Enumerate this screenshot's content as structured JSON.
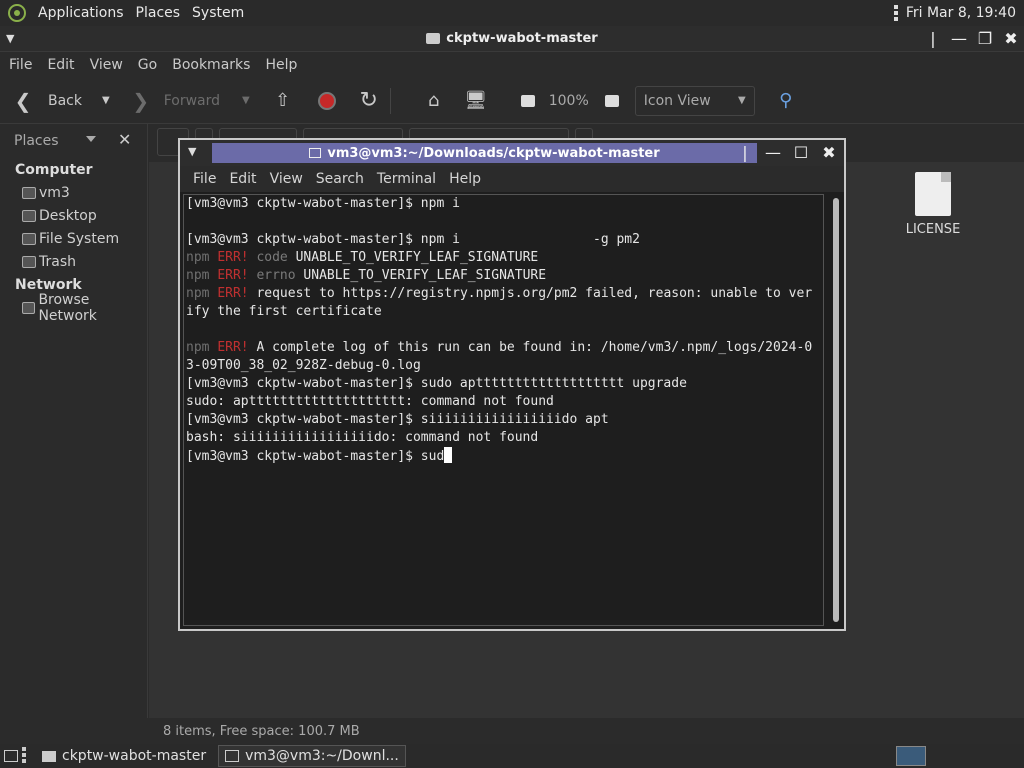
{
  "top_panel": {
    "menus": [
      "Applications",
      "Places",
      "System"
    ],
    "clock": "Fri Mar  8, 19:40"
  },
  "file_manager": {
    "title": "ckptw-wabot-master",
    "menu": [
      "File",
      "Edit",
      "View",
      "Go",
      "Bookmarks",
      "Help"
    ],
    "toolbar": {
      "back": "Back",
      "forward": "Forward",
      "zoom": "100%",
      "view_mode": "Icon View"
    },
    "sidebar": {
      "header": "Places",
      "sections": [
        {
          "title": "Computer",
          "items": [
            "vm3",
            "Desktop",
            "File System",
            "Trash"
          ]
        },
        {
          "title": "Network",
          "items": [
            "Browse Network"
          ]
        }
      ]
    },
    "files": [
      "LICENSE"
    ],
    "status": "8 items, Free space: 100.7 MB"
  },
  "terminal": {
    "title": "vm3@vm3:~/Downloads/ckptw-wabot-master",
    "menu": [
      "File",
      "Edit",
      "View",
      "Search",
      "Terminal",
      "Help"
    ],
    "lines": [
      {
        "t": "[vm3@vm3 ckptw-wabot-master]$ npm i"
      },
      {
        "t": ""
      },
      {
        "t": "[vm3@vm3 ckptw-wabot-master]$ npm i                 -g pm2"
      },
      {
        "npm": "npm",
        "err": "ERR!",
        "dim": "code",
        "t": "UNABLE_TO_VERIFY_LEAF_SIGNATURE"
      },
      {
        "npm": "npm",
        "err": "ERR!",
        "dim": "errno",
        "t": "UNABLE_TO_VERIFY_LEAF_SIGNATURE"
      },
      {
        "npm": "npm",
        "err": "ERR!",
        "t": "request to https://registry.npmjs.org/pm2 failed, reason: unable to ver"
      },
      {
        "t": "ify the first certificate"
      },
      {
        "t": ""
      },
      {
        "npm": "npm",
        "err": "ERR!",
        "t": "A complete log of this run can be found in: /home/vm3/.npm/_logs/2024-0"
      },
      {
        "t": "3-09T00_38_02_928Z-debug-0.log"
      },
      {
        "t": "[vm3@vm3 ckptw-wabot-master]$ sudo apttttttttttttttttttt upgrade"
      },
      {
        "t": "sudo: aptttttttttttttttttttt: command not found"
      },
      {
        "t": "[vm3@vm3 ckptw-wabot-master]$ siiiiiiiiiiiiiiiiido apt"
      },
      {
        "t": "bash: siiiiiiiiiiiiiiiiido: command not found"
      },
      {
        "t": "[vm3@vm3 ckptw-wabot-master]$ sud",
        "cursor": true
      }
    ]
  },
  "taskbar": {
    "tasks": [
      "ckptw-wabot-master",
      "vm3@vm3:~/Downl..."
    ]
  }
}
